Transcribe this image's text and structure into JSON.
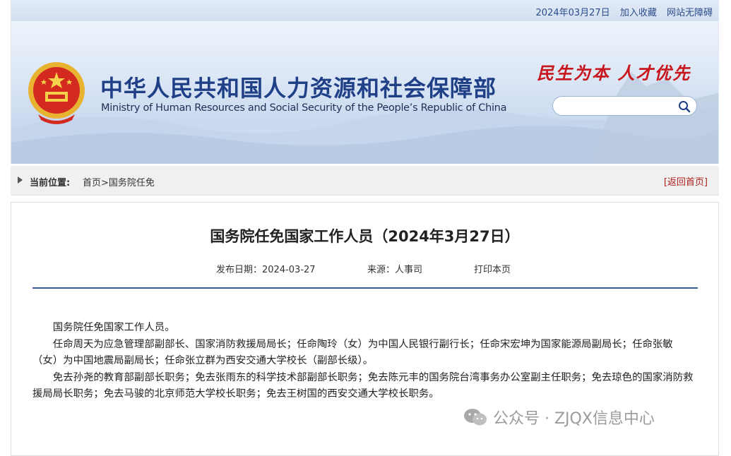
{
  "header": {
    "date": "2024年03月27日",
    "favorite_label": "加入收藏",
    "accessibility_label": "网站无障碍",
    "title_cn": "中华人民共和国人力资源和社会保障部",
    "title_en": "Ministry of Human Resources and Social Security of the People’s Republic of China",
    "slogan": "民生为本 人才优先",
    "search_placeholder": ""
  },
  "breadcrumb": {
    "label": "当前位置:",
    "home": "首页",
    "separator": ">",
    "current": "国务院任免",
    "back_label": "[返回首页]"
  },
  "article": {
    "title": "国务院任免国家工作人员（2024年3月27日）",
    "publish_date": "发布日期：2024-03-27",
    "source": "来源：人事司",
    "print_label": "打印本页",
    "paragraphs": [
      "国务院任免国家工作人员。",
      "任命周天为应急管理部副部长、国家消防救援局局长；任命陶玲（女）为中国人民银行副行长；任命宋宏坤为国家能源局副局长；任命张敏（女）为中国地震局副局长；任命张立群为西安交通大学校长（副部长级）。",
      "免去孙尧的教育部副部长职务；免去张雨东的科学技术部副部长职务；免去陈元丰的国务院台湾事务办公室副主任职务；免去琼色的国家消防救援局局长职务；免去马骏的北京师范大学校长职务；免去王树国的西安交通大学校长职务。"
    ]
  },
  "watermark": {
    "text": "公众号 · ZJQX信息中心"
  },
  "colors": {
    "brand_blue": "#1f3f86",
    "slogan_red": "#c8161d",
    "divider_blue": "#3b5f9e"
  }
}
